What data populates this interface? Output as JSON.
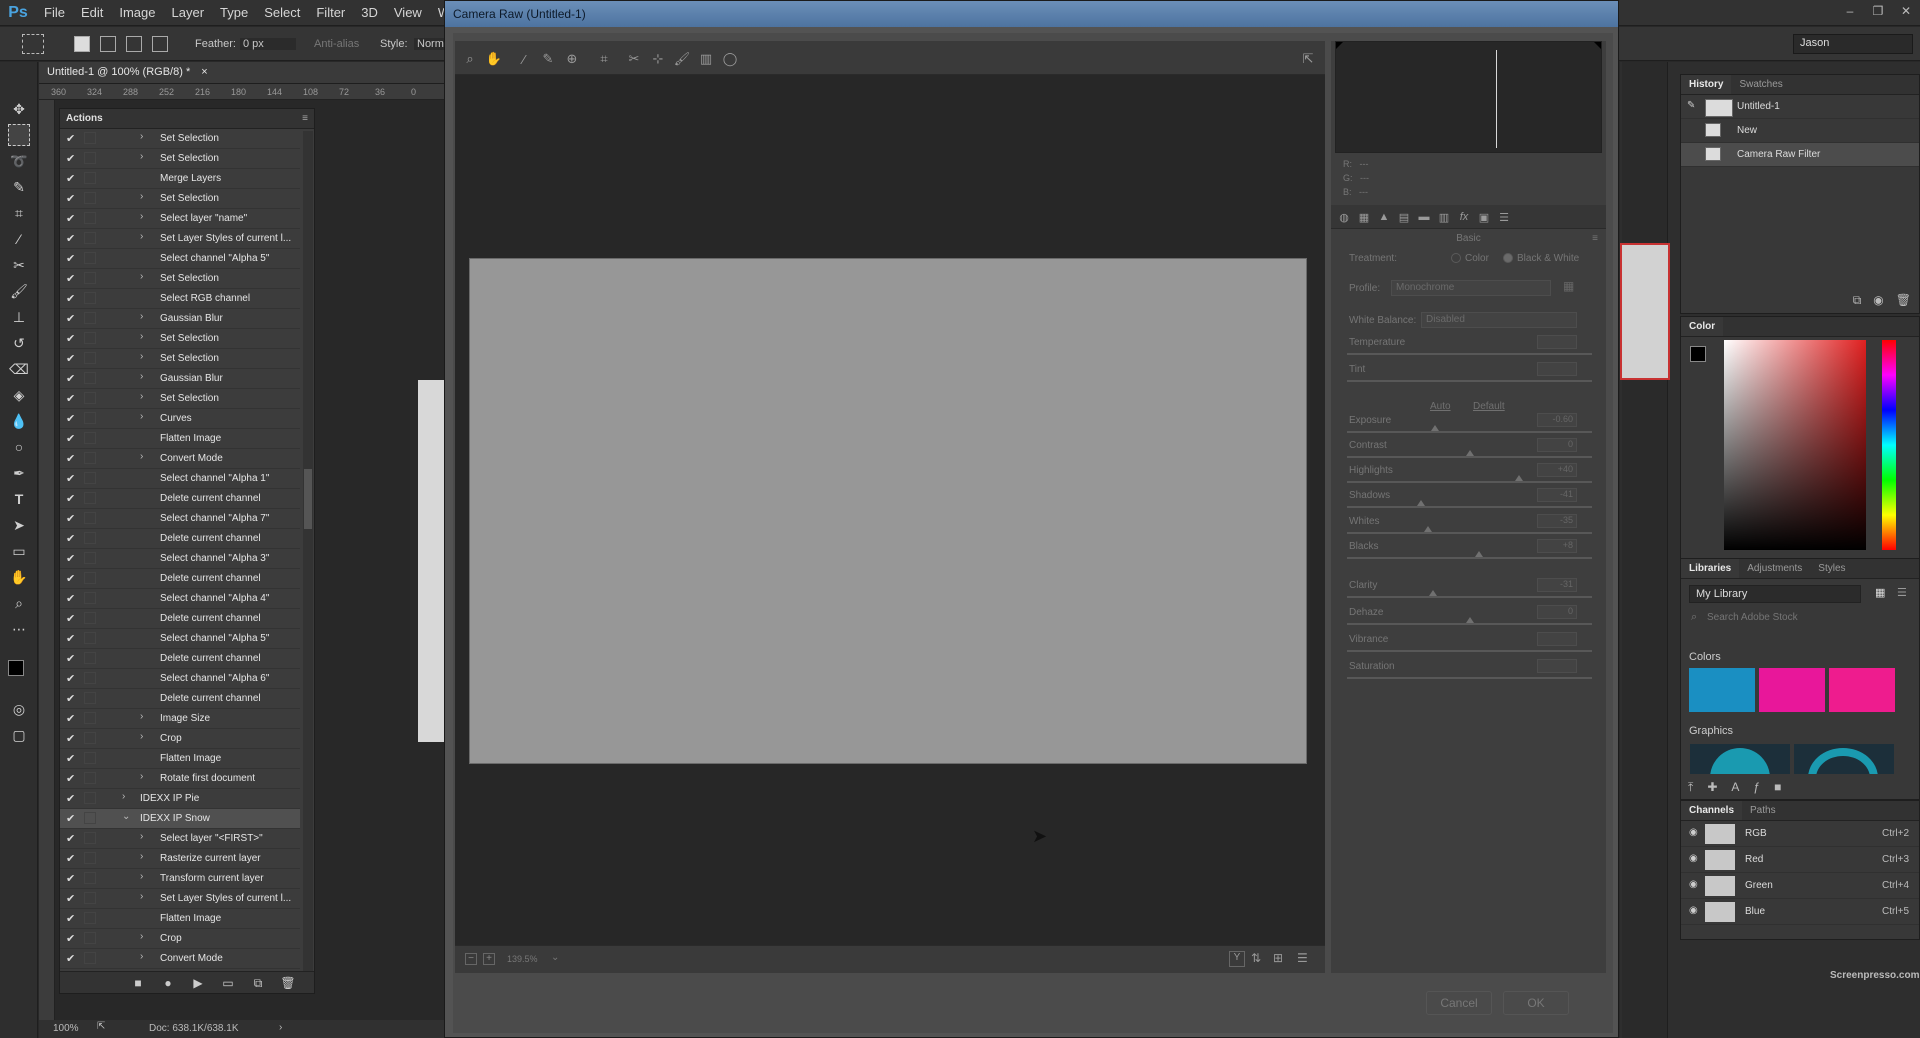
{
  "menubar": {
    "logo": "Ps",
    "items": [
      "File",
      "Edit",
      "Image",
      "Layer",
      "Type",
      "Select",
      "Filter",
      "3D",
      "View",
      "Wi"
    ],
    "window_controls": [
      "–",
      "❐",
      "✕"
    ]
  },
  "options": {
    "feather_label": "Feather:",
    "feather_value": "0 px",
    "anti_alias": "Anti-alias",
    "style_label": "Style:",
    "style_value": "Norm",
    "workspace": "Jason"
  },
  "document": {
    "tab_title": "Untitled-1 @ 100% (RGB/8) *",
    "close": "×",
    "ruler_ticks": [
      "360",
      "324",
      "288",
      "252",
      "216",
      "180",
      "144",
      "108",
      "72",
      "36",
      "0"
    ],
    "zoom": "100%",
    "doc_info": "Doc: 638.1K/638.1K",
    "status_arrow": "›"
  },
  "actions": {
    "title": "Actions",
    "rows": [
      {
        "label": "Set Selection",
        "exp": "›",
        "set": false
      },
      {
        "label": "Set Selection",
        "exp": "›",
        "set": false
      },
      {
        "label": "Merge Layers",
        "exp": "",
        "set": false
      },
      {
        "label": "Set Selection",
        "exp": "›",
        "set": false
      },
      {
        "label": "Select layer \"name\"",
        "exp": "›",
        "set": false
      },
      {
        "label": "Set Layer Styles of current l...",
        "exp": "›",
        "set": false
      },
      {
        "label": "Select channel \"Alpha 5\"",
        "exp": "",
        "set": false
      },
      {
        "label": "Set Selection",
        "exp": "›",
        "set": false
      },
      {
        "label": "Select RGB channel",
        "exp": "",
        "set": false
      },
      {
        "label": "Gaussian Blur",
        "exp": "›",
        "set": false
      },
      {
        "label": "Set Selection",
        "exp": "›",
        "set": false
      },
      {
        "label": "Set Selection",
        "exp": "›",
        "set": false
      },
      {
        "label": "Gaussian Blur",
        "exp": "›",
        "set": false
      },
      {
        "label": "Set Selection",
        "exp": "›",
        "set": false
      },
      {
        "label": "Curves",
        "exp": "›",
        "set": false
      },
      {
        "label": "Flatten Image",
        "exp": "",
        "set": false
      },
      {
        "label": "Convert Mode",
        "exp": "›",
        "set": false
      },
      {
        "label": "Select channel \"Alpha 1\"",
        "exp": "",
        "set": false
      },
      {
        "label": "Delete current channel",
        "exp": "",
        "set": false
      },
      {
        "label": "Select channel \"Alpha 7\"",
        "exp": "",
        "set": false
      },
      {
        "label": "Delete current channel",
        "exp": "",
        "set": false
      },
      {
        "label": "Select channel \"Alpha 3\"",
        "exp": "",
        "set": false
      },
      {
        "label": "Delete current channel",
        "exp": "",
        "set": false
      },
      {
        "label": "Select channel \"Alpha 4\"",
        "exp": "",
        "set": false
      },
      {
        "label": "Delete current channel",
        "exp": "",
        "set": false
      },
      {
        "label": "Select channel \"Alpha 5\"",
        "exp": "",
        "set": false
      },
      {
        "label": "Delete current channel",
        "exp": "",
        "set": false
      },
      {
        "label": "Select channel \"Alpha 6\"",
        "exp": "",
        "set": false
      },
      {
        "label": "Delete current channel",
        "exp": "",
        "set": false
      },
      {
        "label": "Image Size",
        "exp": "›",
        "set": false
      },
      {
        "label": "Crop",
        "exp": "›",
        "set": false
      },
      {
        "label": "Flatten Image",
        "exp": "",
        "set": false
      },
      {
        "label": "Rotate first document",
        "exp": "›",
        "set": false
      },
      {
        "label": "IDEXX IP Pie",
        "exp": "›",
        "set": true
      },
      {
        "label": "IDEXX IP Snow",
        "exp": "⌄",
        "set": true,
        "selected": true
      },
      {
        "label": "Select layer \"<FIRST>\"",
        "exp": "›",
        "set": false
      },
      {
        "label": "Rasterize current layer",
        "exp": "›",
        "set": false
      },
      {
        "label": "Transform current layer",
        "exp": "›",
        "set": false
      },
      {
        "label": "Set Layer Styles of current l...",
        "exp": "›",
        "set": false
      },
      {
        "label": "Flatten Image",
        "exp": "",
        "set": false
      },
      {
        "label": "Crop",
        "exp": "›",
        "set": false
      },
      {
        "label": "Convert Mode",
        "exp": "›",
        "set": false
      }
    ],
    "footer_buttons": [
      "■",
      "●",
      "▶",
      "▭",
      "⧉",
      "🗑"
    ]
  },
  "history": {
    "tabs": [
      "History",
      "Swatches"
    ],
    "snapshot": "Untitled-1",
    "items": [
      "New",
      "Camera Raw Filter"
    ]
  },
  "color_panel": {
    "title": "Color",
    "foreground": "#000000",
    "background": "#ffffff"
  },
  "libraries": {
    "tabs": [
      "Libraries",
      "Adjustments",
      "Styles"
    ],
    "library_name": "My Library",
    "search_placeholder": "Search Adobe Stock",
    "colors_label": "Colors",
    "swatches": [
      "#1a8fc2",
      "#e8179a",
      "#ee1c8e"
    ],
    "graphics_label": "Graphics"
  },
  "channels": {
    "tabs": [
      "Channels",
      "Paths"
    ],
    "rows": [
      {
        "name": "RGB",
        "shortcut": "Ctrl+2"
      },
      {
        "name": "Red",
        "shortcut": "Ctrl+3"
      },
      {
        "name": "Green",
        "shortcut": "Ctrl+4"
      },
      {
        "name": "Blue",
        "shortcut": "Ctrl+5"
      }
    ]
  },
  "camera_raw": {
    "title": "Camera Raw (Untitled-1)",
    "zoom": "139.5%",
    "readout": {
      "r": "R:",
      "g": "G:",
      "b": "B:",
      "dash": "---"
    },
    "panel_name": "Basic",
    "treatment_label": "Treatment:",
    "treatment_color": "Color",
    "treatment_bw": "Black & White",
    "profile_label": "Profile:",
    "profile_value": "Monochrome",
    "wb_label": "White Balance:",
    "wb_value": "Disabled",
    "auto": "Auto",
    "default": "Default",
    "sliders": [
      {
        "label": "Temperature",
        "value": "",
        "pos": null
      },
      {
        "label": "Tint",
        "value": "",
        "pos": null
      },
      {
        "label": "Exposure",
        "value": "-0.60",
        "pos": 0.36
      },
      {
        "label": "Contrast",
        "value": "0",
        "pos": 0.5
      },
      {
        "label": "Highlights",
        "value": "+40",
        "pos": 0.7
      },
      {
        "label": "Shadows",
        "value": "-41",
        "pos": 0.3
      },
      {
        "label": "Whites",
        "value": "-35",
        "pos": 0.33
      },
      {
        "label": "Blacks",
        "value": "+8",
        "pos": 0.54
      },
      {
        "label": "Clarity",
        "value": "-31",
        "pos": 0.35
      },
      {
        "label": "Dehaze",
        "value": "0",
        "pos": 0.5
      },
      {
        "label": "Vibrance",
        "value": "",
        "pos": null
      },
      {
        "label": "Saturation",
        "value": "",
        "pos": null
      }
    ],
    "cancel": "Cancel",
    "ok": "OK"
  },
  "watermark": "Screenpresso.com"
}
